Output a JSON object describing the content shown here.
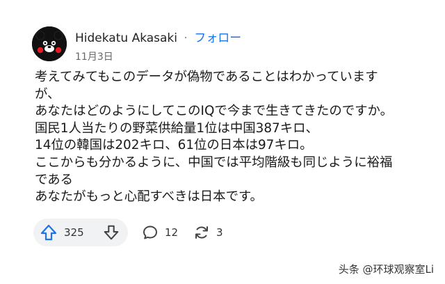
{
  "comment": {
    "author": "Hidekatu Akasaki",
    "separator": "·",
    "follow_label": "フォロー",
    "date": "11月3日",
    "lines": [
      "考えてみてもこのデータが偽物であることはわかっています",
      "が、",
      "あなたはどのようにしてこのIQで今まで生きてきたのですか。",
      "国民1人当たりの野菜供給量1位は中国387キロ、",
      "14位の韓国は202キロ、61位の日本は97キロ。",
      "ここからも分かるように、中国では平均階級も同じように裕福",
      "である",
      "あなたがもっと心配すべきは日本です。"
    ]
  },
  "actions": {
    "upvote_count": "325",
    "comment_count": "12",
    "repost_count": "3"
  },
  "icons": {
    "avatar": "kumamon-avatar",
    "upvote": "arrow-up-icon",
    "downvote": "arrow-down-icon",
    "comment": "speech-bubble-icon",
    "repost": "refresh-arrows-icon"
  },
  "watermark": "头条 @环球观察室Li",
  "colors": {
    "accent": "#1a73e8",
    "upvote_blue": "#1a73e8",
    "pill_bg": "#f1f2f4"
  }
}
